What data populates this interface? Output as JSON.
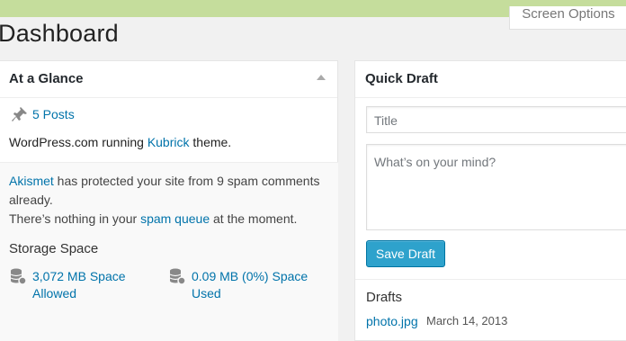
{
  "header": {
    "screen_options": "Screen Options",
    "page_title": "Dashboard"
  },
  "at_a_glance": {
    "title": "At a Glance",
    "posts": "5 Posts",
    "running_prefix": "WordPress.com running ",
    "theme_name": "Kubrick",
    "running_suffix": " theme.",
    "akismet_link": "Akismet",
    "akismet_text": " has protected your site from 9 spam comments already.",
    "queue_prefix": "There’s nothing in your ",
    "queue_link": "spam queue",
    "queue_suffix": " at the moment.",
    "storage_title": "Storage Space",
    "storage_allowed": "3,072 MB Space Allowed",
    "storage_used": "0.09 MB (0%) Space Used"
  },
  "quick_draft": {
    "title": "Quick Draft",
    "title_placeholder": "Title",
    "content_placeholder": "What’s on your mind?",
    "save_label": "Save Draft",
    "drafts_title": "Drafts",
    "draft_items": [
      {
        "title": "photo.jpg",
        "date": "March 14, 2013"
      }
    ]
  },
  "colors": {
    "link": "#0073aa",
    "button": "#2ea2cc",
    "topbar": "#c5dd9c"
  },
  "icons": [
    "pin-icon",
    "database-icon",
    "collapse-arrow-icon"
  ]
}
